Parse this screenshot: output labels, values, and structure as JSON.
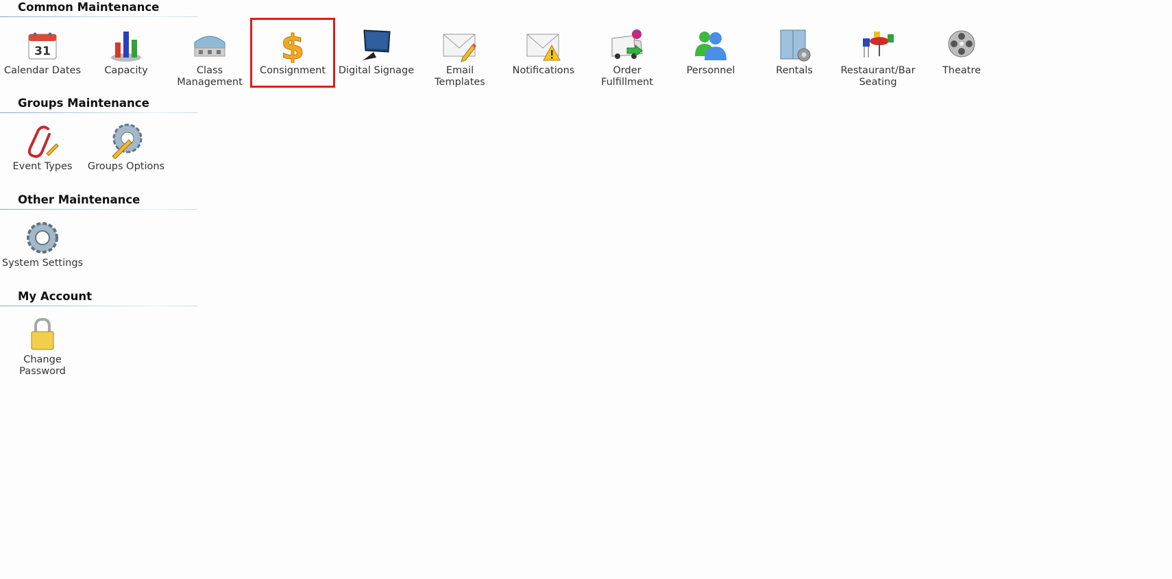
{
  "sections": {
    "common": {
      "title": "Common Maintenance",
      "items": [
        {
          "label": "Calendar Dates",
          "icon": "calendar-icon"
        },
        {
          "label": "Capacity",
          "icon": "bar-chart-icon"
        },
        {
          "label": "Class\nManagement",
          "icon": "building-icon"
        },
        {
          "label": "Consignment",
          "icon": "dollar-icon",
          "selected": true
        },
        {
          "label": "Digital Signage",
          "icon": "monitor-icon"
        },
        {
          "label": "Email\nTemplates",
          "icon": "envelope-pencil-icon"
        },
        {
          "label": "Notifications",
          "icon": "envelope-warning-icon"
        },
        {
          "label": "Order\nFulfillment",
          "icon": "delivery-truck-icon"
        },
        {
          "label": "Personnel",
          "icon": "people-icon"
        },
        {
          "label": "Rentals",
          "icon": "locker-gear-icon"
        },
        {
          "label": "Restaurant/Bar\nSeating",
          "icon": "table-chairs-icon"
        },
        {
          "label": "Theatre",
          "icon": "film-reel-icon"
        }
      ]
    },
    "groups": {
      "title": "Groups Maintenance",
      "items": [
        {
          "label": "Event Types",
          "icon": "paperclip-icon"
        },
        {
          "label": "Groups Options",
          "icon": "gear-pencil-icon"
        }
      ]
    },
    "other": {
      "title": "Other Maintenance",
      "items": [
        {
          "label": "System Settings",
          "icon": "gear-icon"
        }
      ]
    },
    "account": {
      "title": "My Account",
      "items": [
        {
          "label": "Change\nPassword",
          "icon": "padlock-icon"
        }
      ]
    }
  },
  "colors": {
    "selected_outline": "#e21b1b",
    "header_rule": "#7ea9cf"
  }
}
